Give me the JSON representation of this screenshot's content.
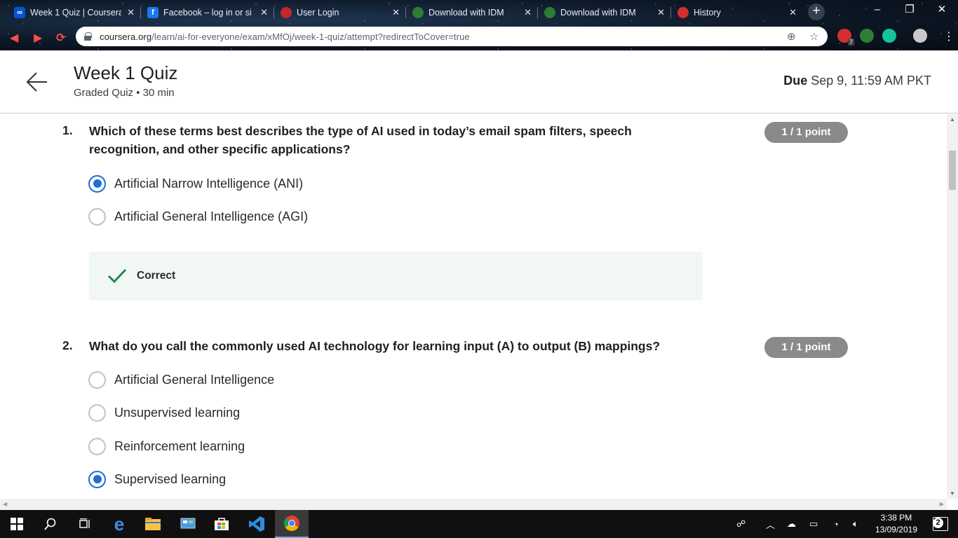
{
  "browser": {
    "tabs": [
      {
        "title": "Week 1 Quiz | Coursera",
        "favicon": "coursera-icon",
        "color": "#0056d2"
      },
      {
        "title": "Facebook – log in or si",
        "favicon": "facebook-icon",
        "color": "#1877f2"
      },
      {
        "title": "User Login",
        "favicon": "user-login-icon",
        "color": "#c62828"
      },
      {
        "title": "Download with IDM",
        "favicon": "idm-icon",
        "color": "#2e7d32"
      },
      {
        "title": "Download with IDM",
        "favicon": "idm-icon",
        "color": "#2e7d32"
      },
      {
        "title": "History",
        "favicon": "history-icon",
        "color": "#d32f2f"
      }
    ],
    "url_host": "coursera.org",
    "url_path": "/learn/ai-for-everyone/exam/xMfOj/week-1-quiz/attempt?redirectToCover=true",
    "ext_badge": "7"
  },
  "header": {
    "title": "Week 1 Quiz",
    "subtitle": "Graded Quiz • 30 min",
    "due_label": "Due",
    "due_value": "Sep 9, 11:59 AM PKT"
  },
  "questions": [
    {
      "number": "1.",
      "text": "Which of these terms best describes the type of AI used in today’s email spam filters, speech recognition, and other specific applications?",
      "points": "1 / 1 point",
      "options": [
        {
          "label": "Artificial Narrow Intelligence (ANI)",
          "selected": true
        },
        {
          "label": "Artificial General Intelligence (AGI)",
          "selected": false
        }
      ],
      "feedback": "Correct"
    },
    {
      "number": "2.",
      "text": "What do you call the commonly used AI technology for learning input (A) to output (B) mappings?",
      "points": "1 / 1 point",
      "options": [
        {
          "label": "Artificial General Intelligence",
          "selected": false
        },
        {
          "label": "Unsupervised learning",
          "selected": false
        },
        {
          "label": "Reinforcement learning",
          "selected": false
        },
        {
          "label": "Supervised learning",
          "selected": true
        }
      ]
    }
  ],
  "taskbar": {
    "time": "3:38 PM",
    "date": "13/09/2019",
    "notifications": "2"
  },
  "colors": {
    "accent": "#1f6ed4",
    "points_badge": "#8a8a8a",
    "correct_bg": "#f1f7f4",
    "correct_check": "#1e8a4e"
  }
}
